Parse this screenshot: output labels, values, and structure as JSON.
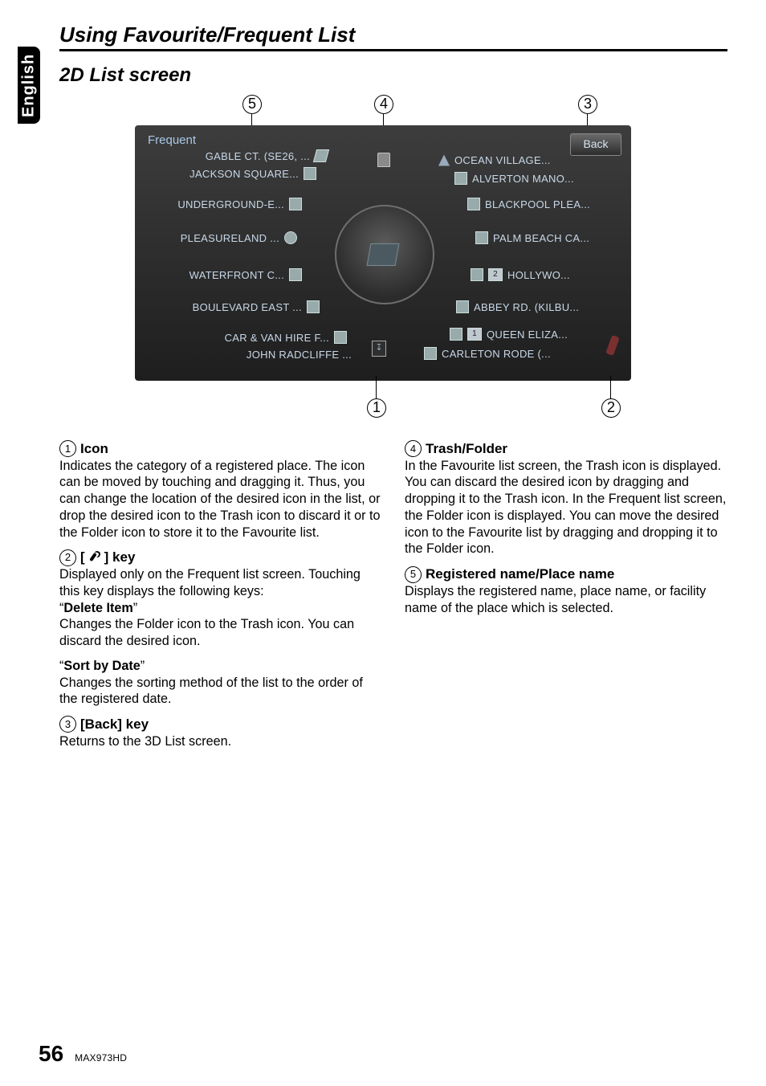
{
  "sideTab": "English",
  "sectionTitle": "Using Favourite/Frequent List",
  "subheading": "2D List screen",
  "callouts": {
    "c1": "1",
    "c2": "2",
    "c3": "3",
    "c4": "4",
    "c5": "5"
  },
  "screenshot": {
    "title": "Frequent",
    "back": "Back",
    "folderIconChar": "↧",
    "leftItems": [
      "GABLE CT. (SE26, ...",
      "JACKSON SQUARE...",
      "UNDERGROUND-E...",
      "PLEASURELAND ...",
      "WATERFRONT C...",
      "BOULEVARD EAST ...",
      "CAR & VAN HIRE F...",
      "JOHN RADCLIFFE ..."
    ],
    "rightItems": [
      "OCEAN VILLAGE...",
      "ALVERTON MANO...",
      "BLACKPOOL PLEA...",
      "PALM BEACH CA...",
      "HOLLYWO...",
      "ABBEY RD. (KILBU...",
      "QUEEN ELIZA...",
      "CARLETON RODE (..."
    ],
    "badge2": "2",
    "badge1": "1"
  },
  "col1": {
    "h1": "Icon",
    "p1": "Indicates the category of a registered place. The icon can be moved by touching and dragging it. Thus, you can change the location of the desired icon in the list, or drop the desired icon to the Trash icon to discard it or to the Folder icon to store it to the Favourite list.",
    "h2a": "[",
    "h2b": "] key",
    "p2a": "Displayed only on the Frequent list screen. Touching this key displays the following keys:",
    "p2b_label": "Delete Item",
    "p2b": "Changes the Folder icon to the Trash icon. You can discard the desired icon.",
    "p2c_label": "Sort by Date",
    "p2c": "Changes the sorting method of the list to the order of the registered date.",
    "h3": "[Back] key",
    "p3": "Returns to the 3D List screen."
  },
  "col2": {
    "h4": "Trash/Folder",
    "p4": "In the Favourite list screen, the Trash icon is displayed. You can discard the desired icon by dragging and dropping it to the Trash icon. In the Frequent list screen, the Folder icon is displayed. You can move the desired icon to the Favourite list by dragging and dropping it to the Folder icon.",
    "h5": "Registered name/Place name",
    "p5": "Displays the registered name, place name, or facility name of the place which is selected."
  },
  "footer": {
    "page": "56",
    "model": "MAX973HD"
  }
}
